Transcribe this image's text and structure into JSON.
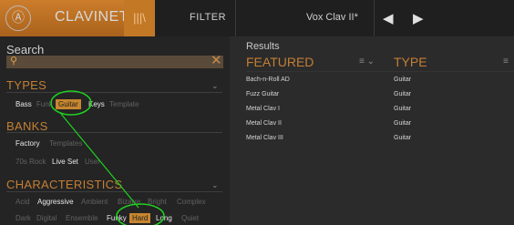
{
  "topbar": {
    "brand": "CLAVINET V",
    "filter_label": "FILTER",
    "preset_name": "Vox Clav II*"
  },
  "search": {
    "title": "Search"
  },
  "types": {
    "title": "TYPES",
    "items": [
      "Bass",
      "Funk",
      "Guitar",
      "Keys",
      "Template"
    ]
  },
  "banks": {
    "title": "BANKS",
    "items": [
      "Factory",
      "Templates",
      "70s Rock",
      "Live Set",
      "User"
    ]
  },
  "characteristics": {
    "title": "CHARACTERISTICS",
    "items": [
      "Acid",
      "Aggressive",
      "Ambient",
      "Bizarre",
      "Bright",
      "Complex",
      "Dark",
      "Digital",
      "Ensemble",
      "Funky",
      "Hard",
      "Long",
      "Quiet"
    ]
  },
  "results": {
    "title": "Results",
    "col_featured": "FEATURED",
    "col_type": "TYPE",
    "rows": [
      {
        "name": "Bach-n-Roll AD",
        "type": "Guitar"
      },
      {
        "name": "Fuzz Guitar",
        "type": "Guitar"
      },
      {
        "name": "Metal Clav I",
        "type": "Guitar"
      },
      {
        "name": "Metal Clav II",
        "type": "Guitar"
      },
      {
        "name": "Metal Clav III",
        "type": "Guitar"
      }
    ]
  },
  "colors": {
    "accent": "#c7862f",
    "highlight_circle": "#1fd11f"
  }
}
